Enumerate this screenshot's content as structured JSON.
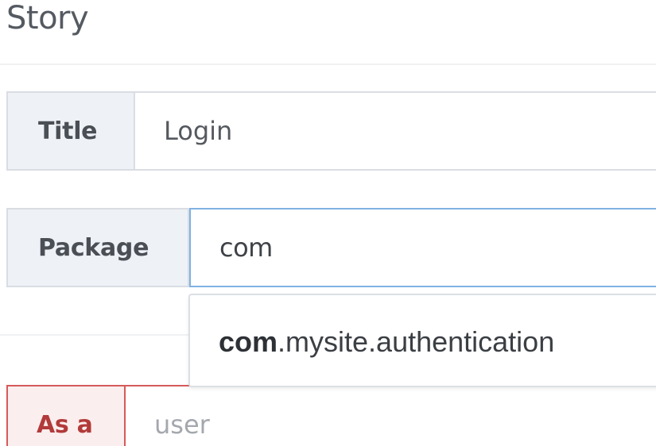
{
  "section": {
    "title": "Story"
  },
  "fields": {
    "title": {
      "label": "Title",
      "value": "Login"
    },
    "package": {
      "label": "Package",
      "value": "com"
    },
    "as_a": {
      "label": "As a",
      "placeholder": "user"
    }
  },
  "autocomplete": {
    "suggestions": [
      {
        "match": "com",
        "rest": ".mysite.authentication"
      }
    ]
  },
  "colors": {
    "focus_border": "#7fb2e3",
    "error_border": "#d65a5a",
    "error_label_text": "#b23a3a",
    "label_bg": "#eef1f6"
  }
}
